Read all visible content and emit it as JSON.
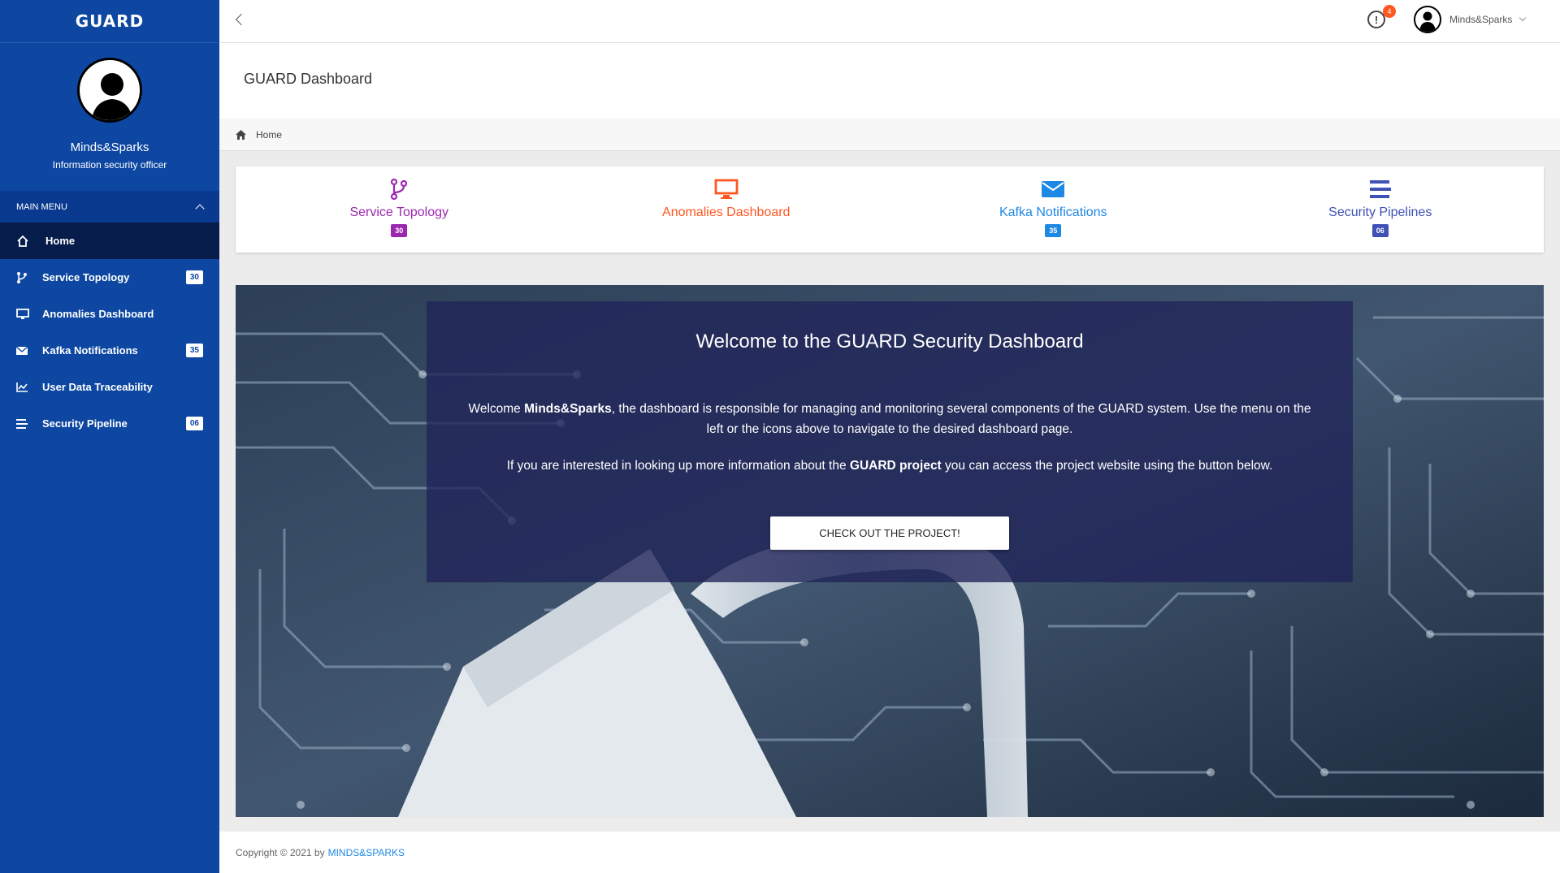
{
  "brand": "GUARD",
  "profile": {
    "name": "Minds&Sparks",
    "role": "Information security officer",
    "avatar_icon": "user-silhouette-icon"
  },
  "sidebar": {
    "menu_header": "MAIN MENU",
    "items": [
      {
        "label": "Home",
        "icon": "home-icon",
        "active": true
      },
      {
        "label": "Service Topology",
        "icon": "branch-icon",
        "badge": "30"
      },
      {
        "label": "Anomalies Dashboard",
        "icon": "monitor-icon"
      },
      {
        "label": "Kafka Notifications",
        "icon": "envelope-icon",
        "badge": "35"
      },
      {
        "label": "User Data Traceability",
        "icon": "chart-line-icon"
      },
      {
        "label": "Security Pipeline",
        "icon": "list-icon",
        "badge": "06"
      }
    ]
  },
  "topbar": {
    "notification_count": "4",
    "notification_icon": "alert-circle-icon",
    "user_name": "Minds&Sparks"
  },
  "page": {
    "title": "GUARD Dashboard",
    "breadcrumb": "Home"
  },
  "quick_links": [
    {
      "label": "Service Topology",
      "badge": "30",
      "icon": "branch-icon",
      "color": "#9c27b0"
    },
    {
      "label": "Anomalies Dashboard",
      "icon": "monitor-icon",
      "color": "#ff5722"
    },
    {
      "label": "Kafka Notifications",
      "badge": "35",
      "icon": "envelope-icon",
      "color": "#1e88e5"
    },
    {
      "label": "Security Pipelines",
      "badge": "06",
      "icon": "list-icon",
      "color": "#3f51b5"
    }
  ],
  "welcome": {
    "title": "Welcome to the GUARD Security Dashboard",
    "p1_prefix": "Welcome ",
    "p1_user": "Minds&Sparks",
    "p1_rest": ", the dashboard is responsible for managing and monitoring several components of the GUARD system. Use the menu on the left or the icons above to navigate to the desired dashboard page.",
    "p2_prefix": "If you are interested in looking up more information about the ",
    "p2_bold": "GUARD project",
    "p2_rest": " you can access the project website using the button below.",
    "button": "CHECK OUT THE PROJECT!"
  },
  "footer": {
    "text": "Copyright © 2021 by",
    "link": "MINDS&SPARKS"
  },
  "colors": {
    "sidebar": "#0d47a1",
    "sidebar_active": "#061c4a",
    "accent_orange": "#ff5722"
  }
}
